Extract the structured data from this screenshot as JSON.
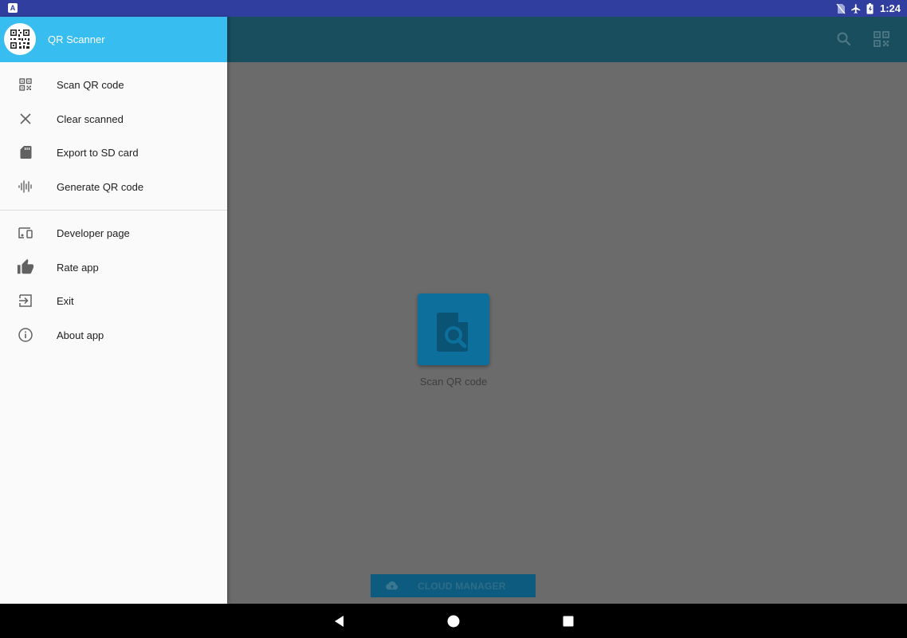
{
  "status_bar": {
    "time": "1:24",
    "notification_icon": "A"
  },
  "toolbar": {
    "search_icon": "search-icon",
    "qr_icon": "qr-code-icon"
  },
  "drawer": {
    "title": "QR Scanner",
    "items_primary": [
      {
        "label": "Scan QR code",
        "icon": "qr-code-icon"
      },
      {
        "label": "Clear scanned",
        "icon": "close-icon"
      },
      {
        "label": "Export to SD card",
        "icon": "sd-card-icon"
      },
      {
        "label": "Generate QR code",
        "icon": "waveform-icon"
      }
    ],
    "items_secondary": [
      {
        "label": "Developer page",
        "icon": "devices-icon"
      },
      {
        "label": "Rate app",
        "icon": "thumb-up-icon"
      },
      {
        "label": "Exit",
        "icon": "exit-icon"
      },
      {
        "label": "About app",
        "icon": "info-icon"
      }
    ]
  },
  "main": {
    "scan_label": "Scan QR code",
    "cloud_button_label": "CLOUD MANAGER"
  },
  "colors": {
    "status_bar": "#303f9f",
    "toolbar": "#184e5e",
    "drawer_header": "#38bdf0",
    "accent": "#0d6f9c"
  }
}
